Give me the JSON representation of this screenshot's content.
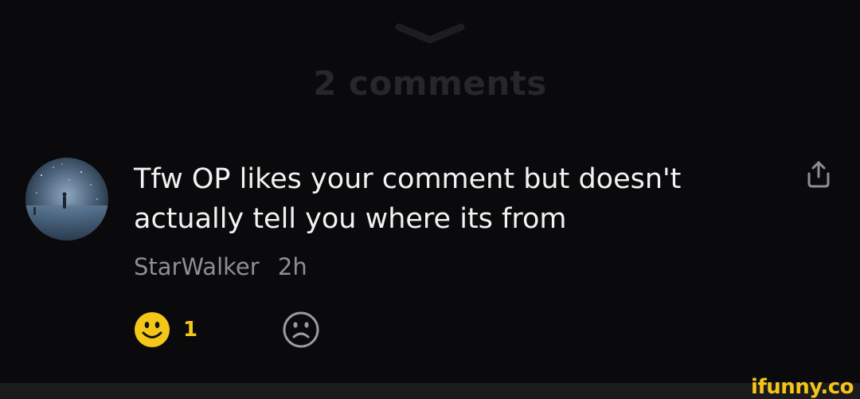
{
  "header": {
    "collapse_icon": "chevron-down-icon",
    "comment_count_title": "2 comments"
  },
  "comment": {
    "avatar_icon": "night-sky-figure-avatar",
    "text": "Tfw OP likes your comment but doesn't actually tell you where its from",
    "author": "StarWalker",
    "time": "2h",
    "share_icon": "share-upload-icon",
    "likes": {
      "icon": "smiley-face-icon",
      "count": "1",
      "color": "#f4c619"
    },
    "dislike_icon": "frown-face-icon"
  },
  "watermark": {
    "text": "ifunny.co",
    "color": "#f5c518"
  }
}
